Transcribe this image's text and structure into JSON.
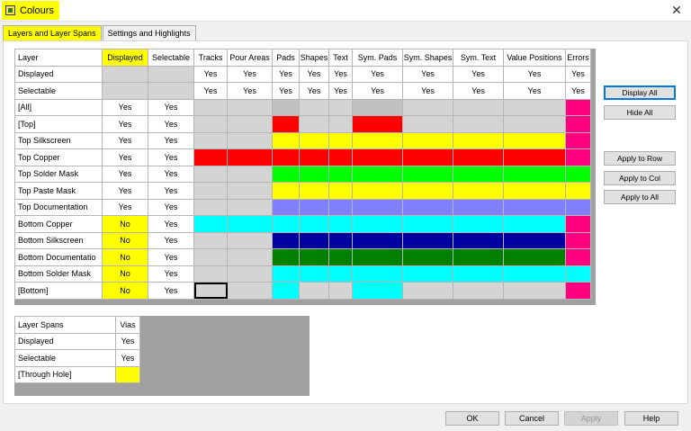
{
  "window": {
    "title": "Colours",
    "close_glyph": "✕"
  },
  "tabs": [
    {
      "label": "Layers and Layer Spans",
      "active": true
    },
    {
      "label": "Settings and Highlights",
      "active": false
    }
  ],
  "colors": {
    "red": "#ff0000",
    "yellow": "#ffff00",
    "green": "#00ff00",
    "cyan": "#00ffff",
    "navy": "#0000a0",
    "darkgreen": "#008000",
    "periwinkle": "#8080ff",
    "magenta": "#ff0080",
    "grey": "#d4d4d4",
    "dgrey": "#c0c0c0"
  },
  "layers_grid": {
    "corner_label": "Layer",
    "column_headers": [
      "Displayed",
      "Selectable",
      "Tracks",
      "Pour Areas",
      "Pads",
      "Shapes",
      "Text",
      "Sym. Pads",
      "Sym. Shapes",
      "Sym. Text",
      "Value Positions",
      "Errors"
    ],
    "displayed_row": {
      "label": "Displayed",
      "values": [
        "",
        "",
        "Yes",
        "Yes",
        "Yes",
        "Yes",
        "Yes",
        "Yes",
        "Yes",
        "Yes",
        "Yes",
        "Yes"
      ]
    },
    "selectable_row": {
      "label": "Selectable",
      "values": [
        "",
        "",
        "Yes",
        "Yes",
        "Yes",
        "Yes",
        "Yes",
        "Yes",
        "Yes",
        "Yes",
        "Yes",
        "Yes"
      ]
    },
    "rows": [
      {
        "label": "[All]",
        "displayed": "Yes",
        "selectable": "Yes",
        "cells": [
          "grey",
          "grey",
          "dgrey",
          "grey",
          "grey",
          "dgrey",
          "grey",
          "grey",
          "grey",
          "magenta"
        ]
      },
      {
        "label": "[Top]",
        "displayed": "Yes",
        "selectable": "Yes",
        "cells": [
          "grey",
          "grey",
          "red",
          "grey",
          "grey",
          "red",
          "grey",
          "grey",
          "grey",
          "magenta"
        ]
      },
      {
        "label": "Top Silkscreen",
        "displayed": "Yes",
        "selectable": "Yes",
        "cells": [
          "grey",
          "grey",
          "yellow",
          "yellow",
          "yellow",
          "yellow",
          "yellow",
          "yellow",
          "yellow",
          "magenta"
        ]
      },
      {
        "label": "Top Copper",
        "displayed": "Yes",
        "selectable": "Yes",
        "cells": [
          "red",
          "red",
          "red",
          "red",
          "red",
          "red",
          "red",
          "red",
          "red",
          "magenta"
        ]
      },
      {
        "label": "Top Solder Mask",
        "displayed": "Yes",
        "selectable": "Yes",
        "cells": [
          "grey",
          "grey",
          "green",
          "green",
          "green",
          "green",
          "green",
          "green",
          "green",
          "green"
        ]
      },
      {
        "label": "Top Paste Mask",
        "displayed": "Yes",
        "selectable": "Yes",
        "cells": [
          "grey",
          "grey",
          "yellow",
          "yellow",
          "yellow",
          "yellow",
          "yellow",
          "yellow",
          "yellow",
          "yellow"
        ]
      },
      {
        "label": "Top Documentation",
        "displayed": "Yes",
        "selectable": "Yes",
        "cells": [
          "grey",
          "grey",
          "periwinkle",
          "periwinkle",
          "periwinkle",
          "periwinkle",
          "periwinkle",
          "periwinkle",
          "periwinkle",
          "periwinkle"
        ]
      },
      {
        "label": "Bottom Copper",
        "displayed": "No",
        "selectable": "Yes",
        "cells": [
          "cyan",
          "cyan",
          "cyan",
          "cyan",
          "cyan",
          "cyan",
          "cyan",
          "cyan",
          "cyan",
          "magenta"
        ]
      },
      {
        "label": "Bottom Silkscreen",
        "displayed": "No",
        "selectable": "Yes",
        "cells": [
          "grey",
          "grey",
          "navy",
          "navy",
          "navy",
          "navy",
          "navy",
          "navy",
          "navy",
          "magenta"
        ]
      },
      {
        "label": "Bottom Documentatio",
        "displayed": "No",
        "selectable": "Yes",
        "cells": [
          "grey",
          "grey",
          "darkgreen",
          "darkgreen",
          "darkgreen",
          "darkgreen",
          "darkgreen",
          "darkgreen",
          "darkgreen",
          "magenta"
        ]
      },
      {
        "label": "Bottom Solder Mask",
        "displayed": "No",
        "selectable": "Yes",
        "cells": [
          "grey",
          "grey",
          "cyan",
          "cyan",
          "cyan",
          "cyan",
          "cyan",
          "cyan",
          "cyan",
          "cyan"
        ]
      },
      {
        "label": "[Bottom]",
        "displayed": "No",
        "selectable": "Yes",
        "cells": [
          "selected",
          "grey",
          "cyan",
          "grey",
          "grey",
          "cyan",
          "grey",
          "grey",
          "grey",
          "magenta"
        ]
      }
    ]
  },
  "spans_grid": {
    "corner_label": "Layer Spans",
    "column_header": "Vias",
    "rows": [
      {
        "label": "Displayed",
        "value": "Yes"
      },
      {
        "label": "Selectable",
        "value": "Yes"
      },
      {
        "label": "[Through Hole]",
        "value": "",
        "color": "yellow"
      }
    ]
  },
  "side_buttons": [
    {
      "name": "display-all-button",
      "label": "Display All"
    },
    {
      "name": "hide-all-button",
      "label": "Hide All"
    },
    {
      "name": "apply-to-row-button",
      "label": "Apply to Row"
    },
    {
      "name": "apply-to-col-button",
      "label": "Apply to Col"
    },
    {
      "name": "apply-to-all-button",
      "label": "Apply to All"
    }
  ],
  "bottom_buttons": [
    {
      "name": "ok-button",
      "label": "OK"
    },
    {
      "name": "cancel-button",
      "label": "Cancel"
    },
    {
      "name": "apply-button",
      "label": "Apply"
    },
    {
      "name": "help-button",
      "label": "Help"
    }
  ]
}
